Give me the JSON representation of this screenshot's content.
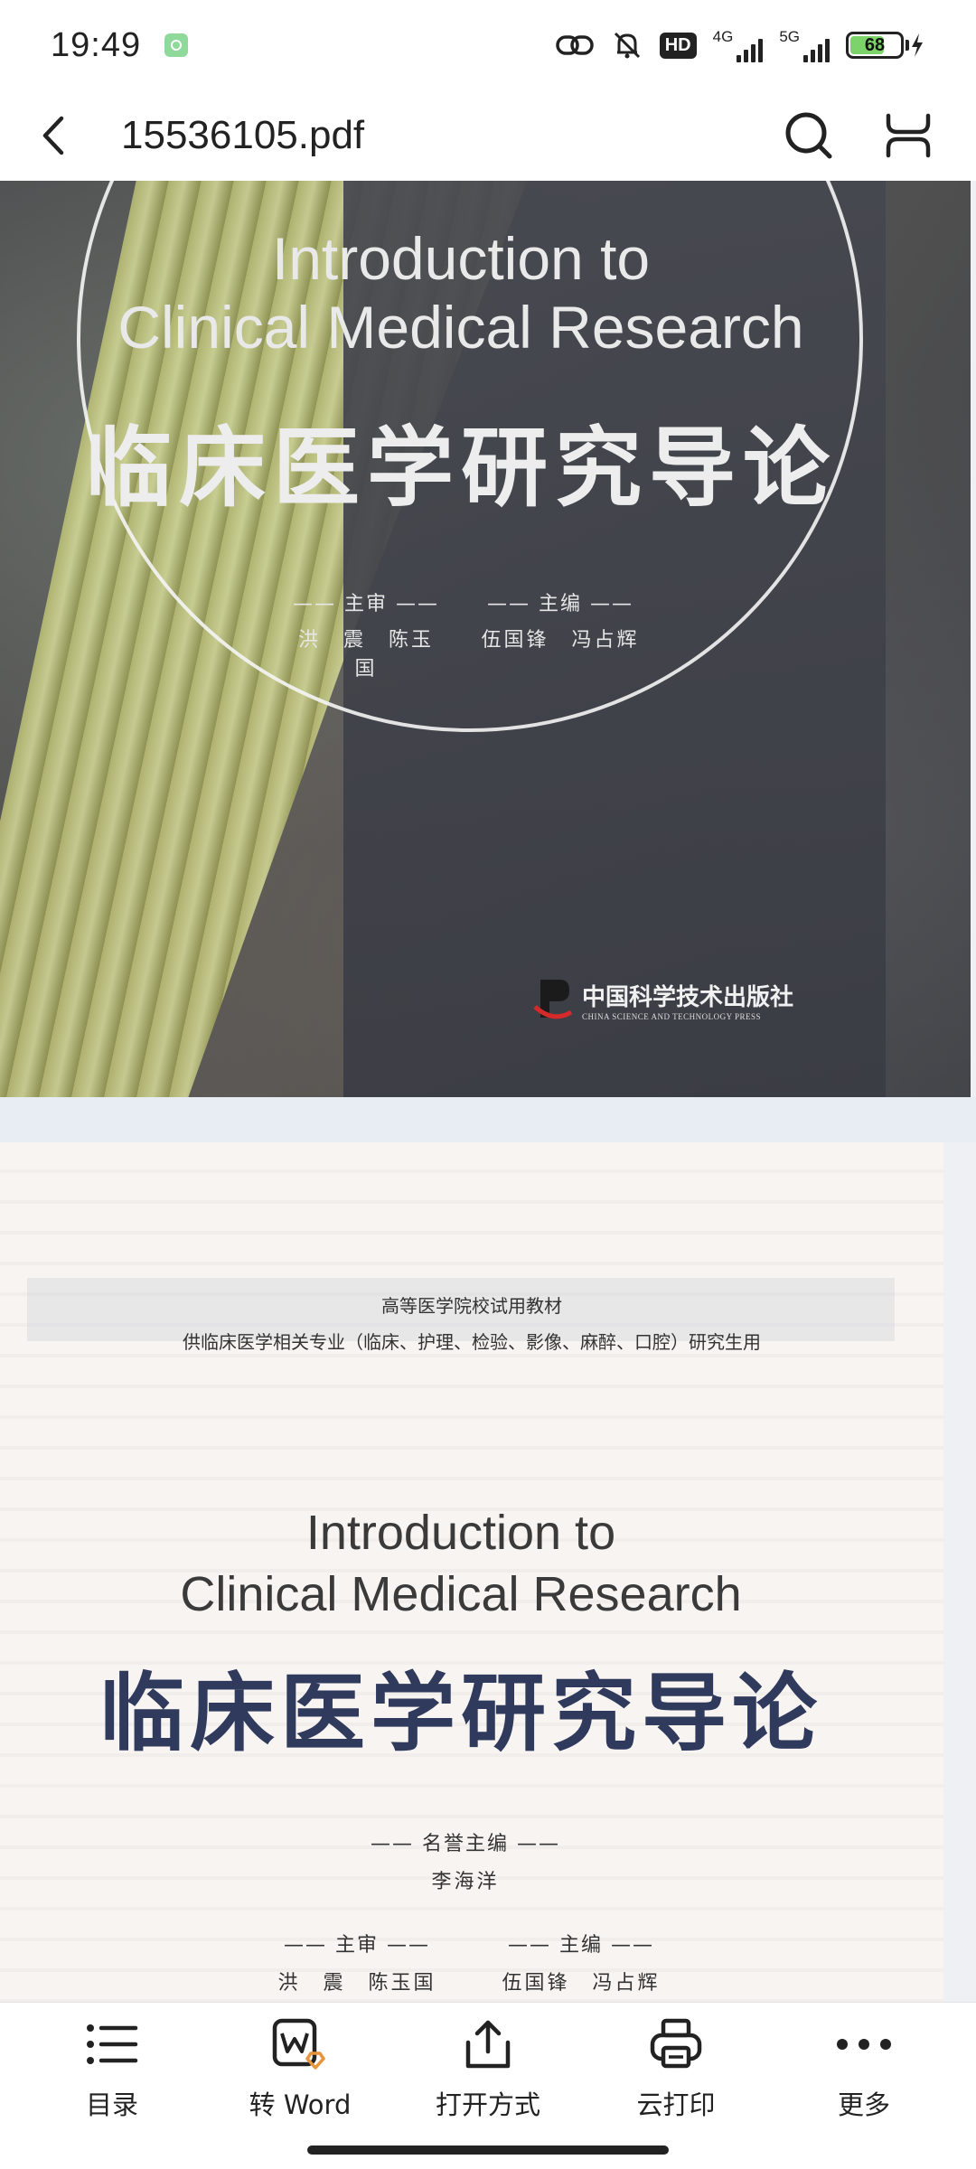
{
  "status_bar": {
    "time": "19:49",
    "hd_badge": "HD",
    "net1_label": "4G",
    "net2_label": "5G",
    "battery_percent": "68",
    "battery_level": 0.68,
    "battery_color": "#7bd36a"
  },
  "title_bar": {
    "title": "15536105.pdf",
    "back_icon": "chevron-left-icon",
    "search_icon": "search-icon",
    "reading_mode_icon": "reading-mode-icon"
  },
  "page1": {
    "en_line1": "Introduction to",
    "en_line2": "Clinical Medical Research",
    "cn_title": "临床医学研究导论",
    "reviewers_role": "—— 主审 ——",
    "reviewers_names": "洪　震　陈玉国",
    "editors_role": "—— 主编 ——",
    "editors_names": "伍国锋　冯占辉",
    "publisher_cn": "中国科学技术出版社",
    "publisher_en": "CHINA SCIENCE AND TECHNOLOGY PRESS"
  },
  "page2": {
    "series": "高等医学院校试用教材",
    "audience": "供临床医学相关专业（临床、护理、检验、影像、麻醉、口腔）研究生用",
    "en_line1": "Introduction to",
    "en_line2": "Clinical Medical Research",
    "cn_title": "临床医学研究导论",
    "honorary_role": "—— 名誉主编 ——",
    "honorary_name": "李海洋",
    "reviewers_role": "—— 主审 ——",
    "reviewers_names": "洪　震　陈玉国",
    "editors_role": "—— 主编 ——",
    "editors_names": "伍国锋　冯占辉"
  },
  "toolbar": {
    "items": [
      {
        "label": "目录",
        "icon": "list-icon"
      },
      {
        "label": "转 Word",
        "icon": "convert-word-icon"
      },
      {
        "label": "打开方式",
        "icon": "share-icon"
      },
      {
        "label": "云打印",
        "icon": "printer-icon"
      },
      {
        "label": "更多",
        "icon": "more-icon"
      }
    ]
  }
}
